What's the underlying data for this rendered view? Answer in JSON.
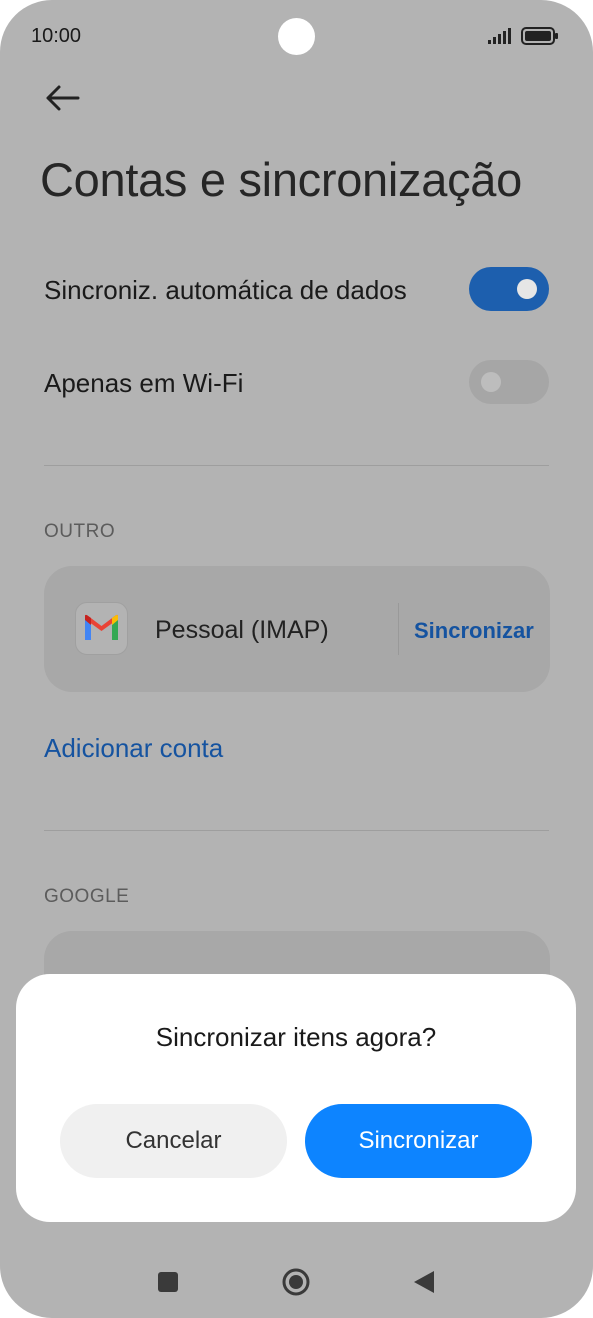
{
  "status_bar": {
    "time": "10:00"
  },
  "header": {
    "title": "Contas e sincronização"
  },
  "settings": {
    "auto_sync": {
      "label": "Sincroniz. automática de dados",
      "on": true
    },
    "wifi_only": {
      "label": "Apenas em Wi-Fi",
      "on": false
    }
  },
  "sections": {
    "other": {
      "label": "OUTRO",
      "account": {
        "name": "Pessoal (IMAP)",
        "icon": "gmail-icon",
        "sync_label": "Sincronizar"
      },
      "add_account": "Adicionar conta"
    },
    "google": {
      "label": "GOOGLE"
    }
  },
  "dialog": {
    "title": "Sincronizar itens agora?",
    "cancel_label": "Cancelar",
    "confirm_label": "Sincronizar"
  },
  "nav": {
    "icons": [
      "recents-square-icon",
      "home-circle-icon",
      "back-triangle-icon"
    ]
  },
  "colors": {
    "accent": "#0d84ff",
    "link": "#1553a0",
    "toggle_on": "#1d5fae",
    "scrim": "#b3b3b3"
  }
}
